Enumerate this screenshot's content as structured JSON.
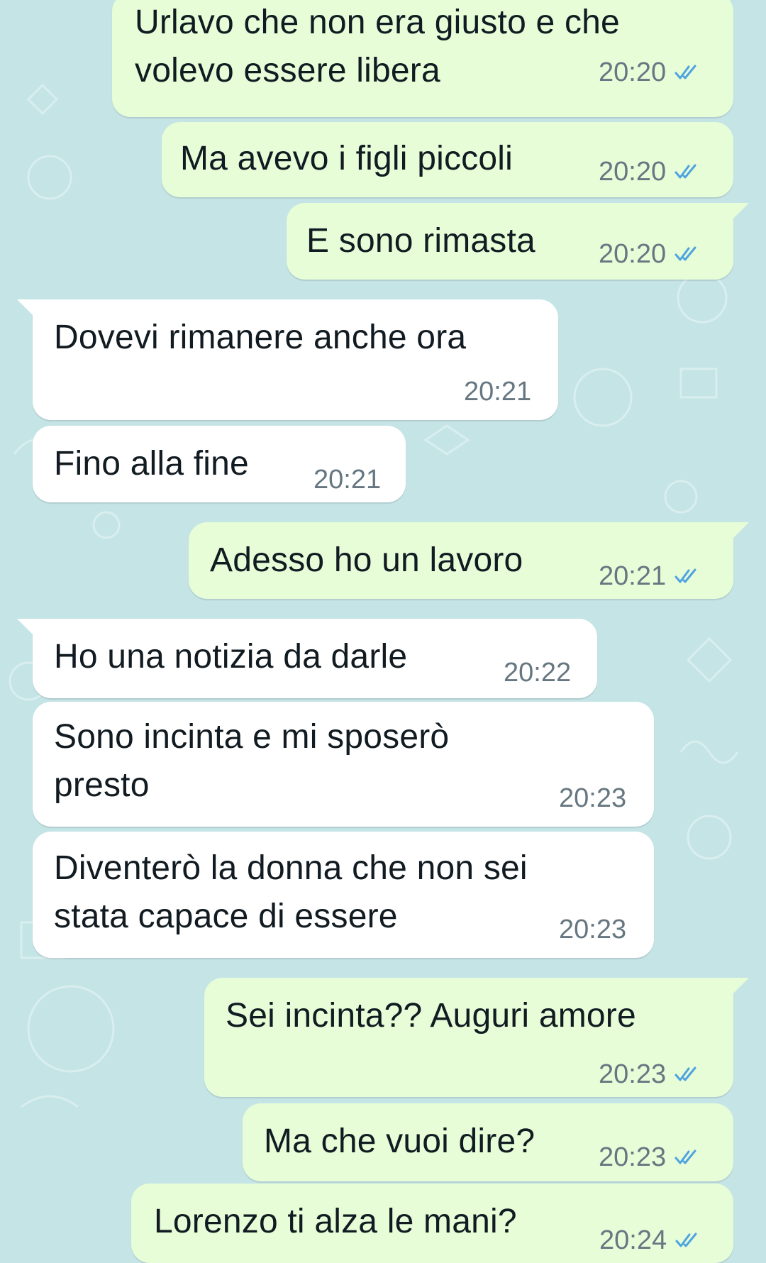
{
  "chat": {
    "messages": [
      {
        "dir": "out",
        "text": "Urlavo che non era giusto e che\nvolevo essere libera",
        "time": "20:20",
        "read": true
      },
      {
        "dir": "out",
        "text": "Ma avevo i figli piccoli",
        "time": "20:20",
        "read": true
      },
      {
        "dir": "out",
        "text": "E sono rimasta",
        "time": "20:20",
        "read": true
      },
      {
        "dir": "in",
        "text": "Dovevi rimanere anche ora",
        "time": "20:21"
      },
      {
        "dir": "in",
        "text": "Fino alla fine",
        "time": "20:21"
      },
      {
        "dir": "out",
        "text": "Adesso ho un lavoro",
        "time": "20:21",
        "read": true
      },
      {
        "dir": "in",
        "text": "Ho una notizia da darle",
        "time": "20:22"
      },
      {
        "dir": "in",
        "text": "Sono incinta e mi sposerò\npresto",
        "time": "20:23"
      },
      {
        "dir": "in",
        "text": "Diventerò la donna che non sei\nstata capace di essere",
        "time": "20:23"
      },
      {
        "dir": "out",
        "text": "Sei incinta?? Auguri amore",
        "time": "20:23",
        "read": true
      },
      {
        "dir": "out",
        "text": "Ma che vuoi dire?",
        "time": "20:23",
        "read": true
      },
      {
        "dir": "out",
        "text": "Lorenzo ti alza le mani?",
        "time": "20:24",
        "read": true
      }
    ]
  },
  "colors": {
    "wallpaper": "#c5e4e6",
    "outgoing_bubble": "#e6fdd8",
    "incoming_bubble": "#ffffff",
    "read_tick": "#4fa3e0",
    "timestamp": "#667781"
  },
  "icons": {
    "read_receipt": "double-check-icon"
  }
}
